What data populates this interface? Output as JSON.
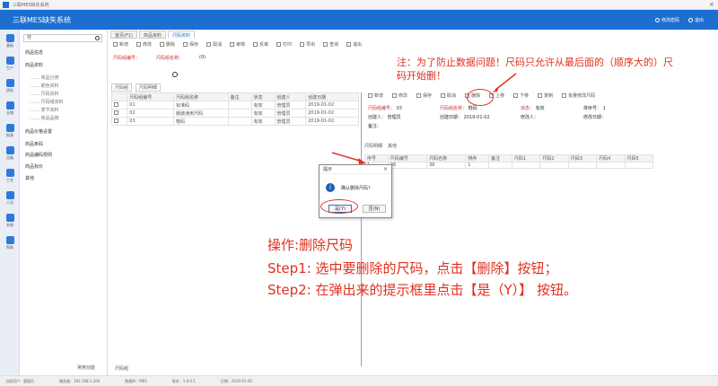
{
  "window": {
    "title": "三联MES缺失系统"
  },
  "header": {
    "brand": "三联MES缺失系统",
    "links": [
      "修改密码",
      "退出"
    ]
  },
  "rail": {
    "items": [
      "基础",
      "生产",
      "质检",
      "仓储",
      "报表",
      "设备",
      "工艺",
      "人员",
      "系统",
      "帮助"
    ]
  },
  "tree": {
    "search_value": "鞋",
    "items": [
      {
        "label": "商品信息",
        "sub": false
      },
      {
        "label": "商品资料",
        "sub": false
      },
      {
        "label": "…… 商品分类",
        "sub": true
      },
      {
        "label": "…… 颜色资料",
        "sub": true
      },
      {
        "label": "…… 尺码资料",
        "sub": true
      },
      {
        "label": "…… 尺码组资料",
        "sub": true
      },
      {
        "label": "…… 季节资料",
        "sub": true
      },
      {
        "label": "…… 商品品牌",
        "sub": true
      },
      {
        "label": "商品价格设置",
        "sub": false
      },
      {
        "label": "商品条码",
        "sub": false
      },
      {
        "label": "商品编码规则",
        "sub": false
      },
      {
        "label": "商品标价",
        "sub": false
      },
      {
        "label": "其他",
        "sub": false
      }
    ],
    "footer": "常用功能"
  },
  "main": {
    "tabs": [
      "首页(F1)",
      "商品资料",
      "尺码资料"
    ],
    "toolbar": [
      "新增",
      "修改",
      "删除",
      "保存",
      "取消",
      "审核",
      "反审",
      "打印",
      "导出",
      "查询",
      "退出"
    ],
    "filters": {
      "label1": "尺码组编号：",
      "value1": "",
      "label2": "尺码组名称：",
      "value2": "(0)"
    },
    "subtabs": [
      "尺码组",
      "尺码明细"
    ],
    "grid": {
      "headers": [
        "",
        "尺码组编号",
        "尺码组名称",
        "备注",
        "状态",
        "创建人",
        "创建日期"
      ],
      "rows": [
        [
          "",
          "01",
          "标准码",
          "",
          "有效",
          "管理员",
          "2019-01-02"
        ],
        [
          "",
          "02",
          "服装通用尺码",
          "",
          "有效",
          "管理员",
          "2019-01-02"
        ],
        [
          "",
          "03",
          "鞋码",
          "",
          "有效",
          "管理员",
          "2019-01-02"
        ]
      ]
    }
  },
  "right": {
    "toolbar": [
      "新增",
      "修改",
      "保存",
      "取消",
      "删除",
      "上移",
      "下移",
      "复制",
      "批量修改尺码"
    ],
    "form": [
      {
        "label": "尺码组编号：",
        "value": "03",
        "red": true
      },
      {
        "label": "尺码组名称：",
        "value": "鞋码",
        "red": true
      },
      {
        "label": "状态：",
        "value": "有效",
        "red": true
      },
      {
        "label": "排序号：",
        "value": "1",
        "red": false
      },
      {
        "label": "创建人：",
        "value": "管理员",
        "red": false
      },
      {
        "label": "创建日期：",
        "value": "2019-01-02",
        "red": false
      },
      {
        "label": "修改人：",
        "value": "",
        "red": false
      },
      {
        "label": "修改日期：",
        "value": "",
        "red": false
      },
      {
        "label": "备注：",
        "value": "",
        "red": false
      }
    ],
    "tabs": [
      "尺码明细",
      "其他"
    ],
    "grid": {
      "headers": [
        "序号",
        "尺码编号",
        "尺码名称",
        "排序",
        "备注",
        "尺码1",
        "尺码2",
        "尺码3",
        "尺码4",
        "尺码5"
      ],
      "rows": [
        [
          "1",
          "36",
          "36",
          "1",
          "",
          "",
          "",
          "",
          "",
          ""
        ]
      ]
    }
  },
  "dialog": {
    "title": "提示",
    "icon": "i",
    "message": "确认删除尺码？",
    "yes_label": "是(Y)",
    "no_label": "否(N)"
  },
  "annotations": {
    "note": "注：为了防止数据问题！尺码只允许从最后面的（顺序大的）尺码开始删！",
    "instruction_title": "操作:删除尺码",
    "step1": "Step1: 选中要删除的尺码，点击【删除】按钮；",
    "step2": "Step2: 在弹出来的提示框里点击【是（Y）】 按钮。"
  },
  "status": {
    "items": [
      "当前用户：管理员",
      "服务器：192.168.1.100",
      "数据库：MES",
      "版本：1.0.0.1",
      "日期：2019-01-02"
    ]
  },
  "colors": {
    "header": "#1c6fd1",
    "annotation": "#e03020",
    "dialog_icon": "#1d5fb5"
  }
}
